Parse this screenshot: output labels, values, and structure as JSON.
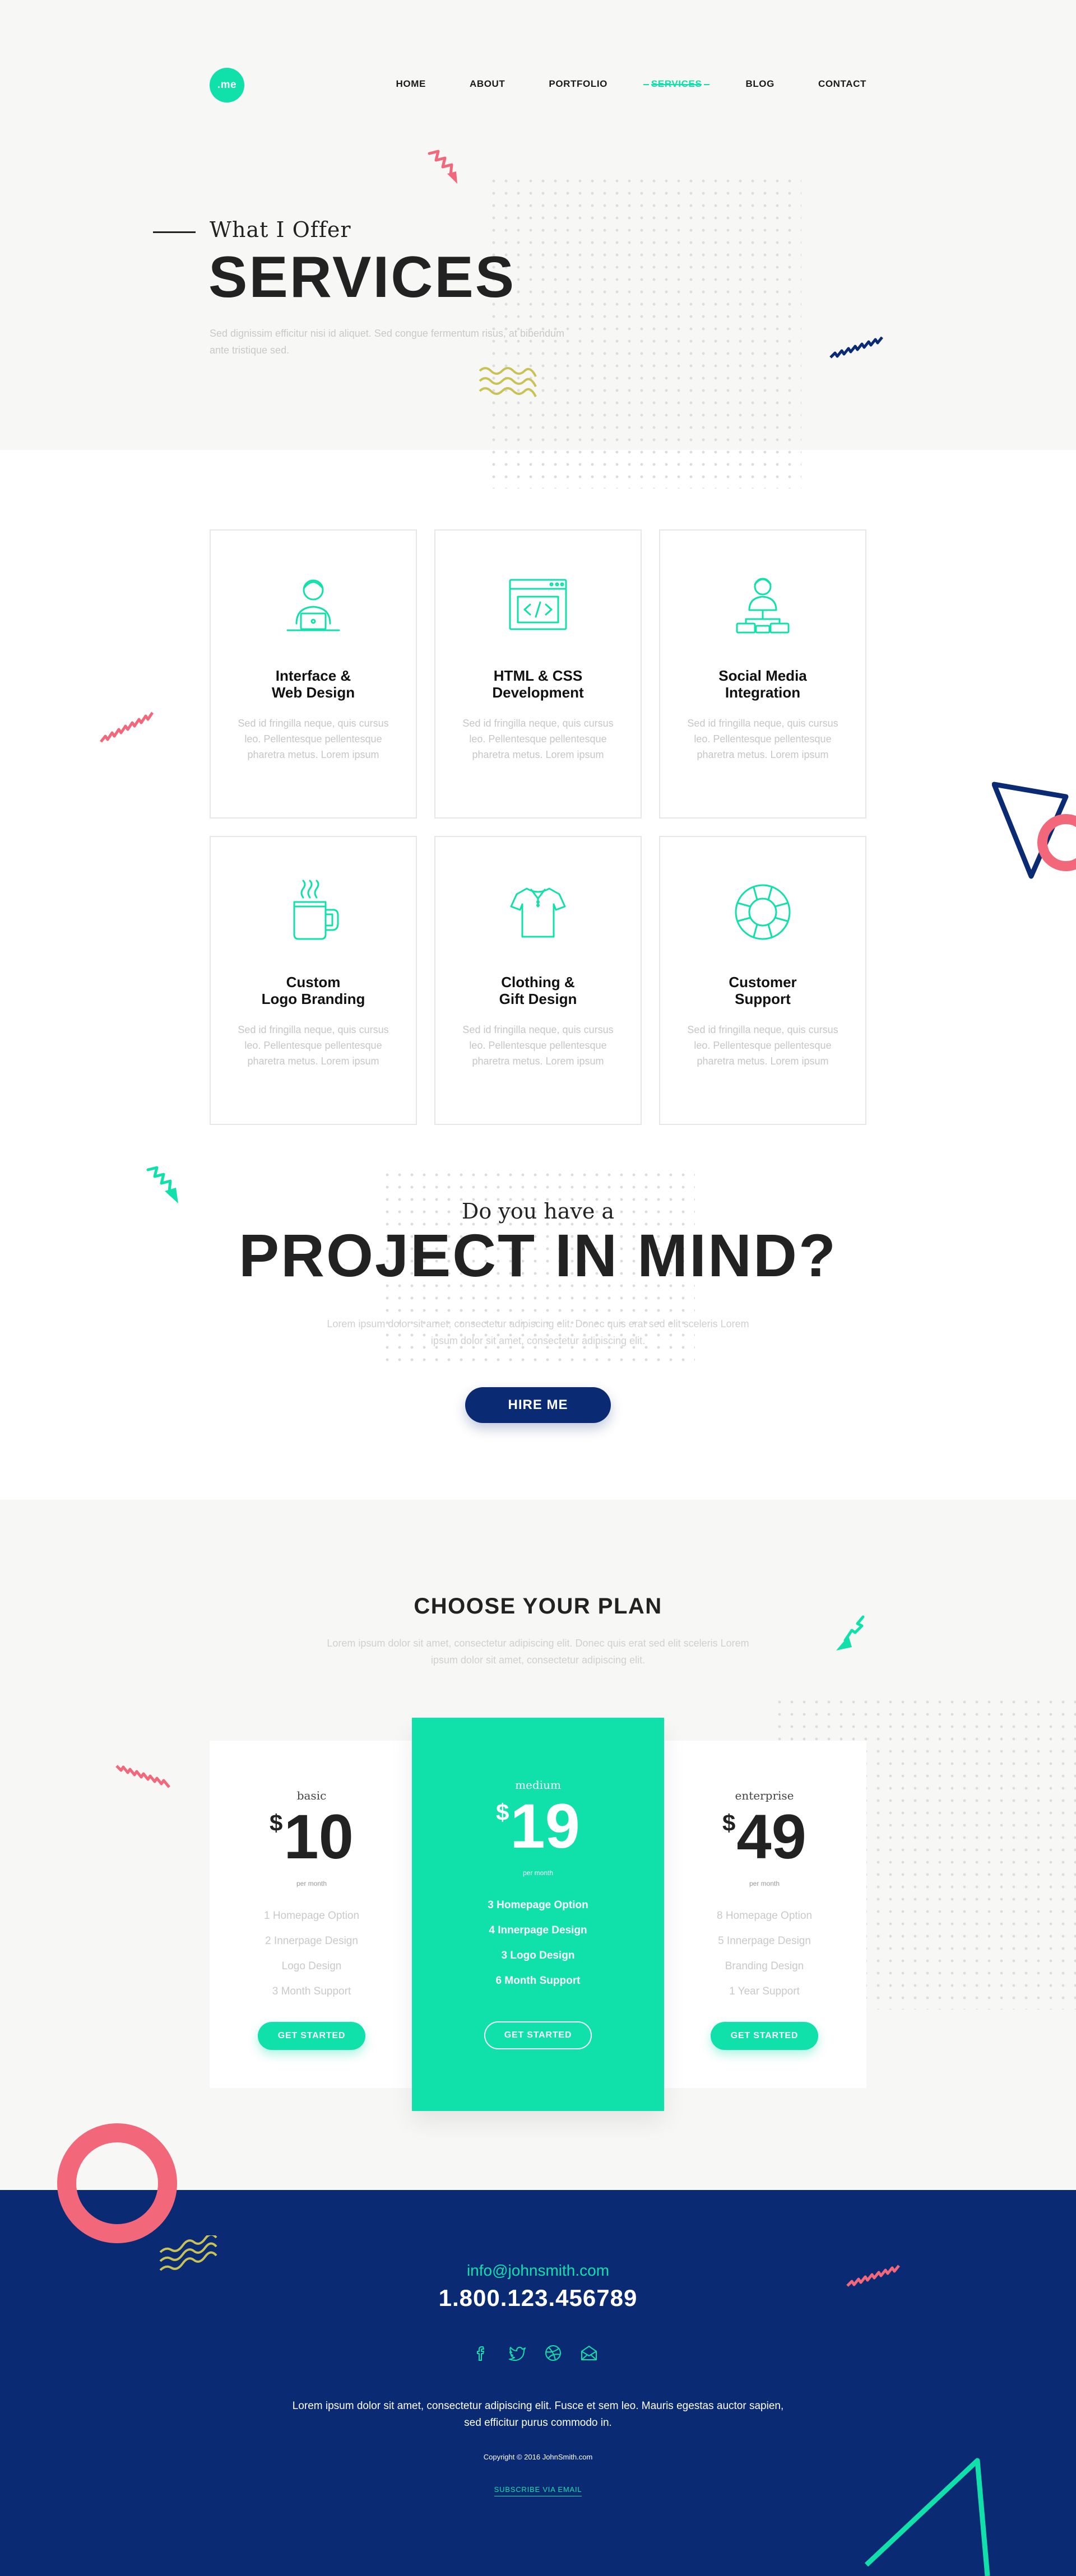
{
  "brand": {
    "logo_text": ".me",
    "accent": "#10e0aa",
    "navy": "#0a2a74",
    "coral": "#f2677a",
    "olive": "#c9c255"
  },
  "nav": {
    "items": [
      "HOME",
      "ABOUT",
      "PORTFOLIO",
      "SERVICES",
      "BLOG",
      "CONTACT"
    ],
    "active": "SERVICES"
  },
  "hero": {
    "subtitle": "What I Offer",
    "title": "SERVICES",
    "description": "Sed dignissim efficitur nisi id aliquet. Sed congue fermentum risus, at bibendum ante tristique sed."
  },
  "services": [
    {
      "icon": "designer-laptop-icon",
      "title": "Interface &\nWeb Design",
      "text": "Sed id fringilla neque, quis cursus leo. Pellentesque pellentesque pharetra metus. Lorem ipsum"
    },
    {
      "icon": "code-window-icon",
      "title": "HTML & CSS\nDevelopment",
      "text": "Sed id fringilla neque, quis cursus leo. Pellentesque pellentesque pharetra metus. Lorem ipsum"
    },
    {
      "icon": "network-person-icon",
      "title": "Social Media\nIntegration",
      "text": "Sed id fringilla neque, quis cursus leo. Pellentesque pellentesque pharetra metus. Lorem ipsum"
    },
    {
      "icon": "coffee-mug-icon",
      "title": "Custom\nLogo Branding",
      "text": "Sed id fringilla neque, quis cursus leo. Pellentesque pellentesque pharetra metus. Lorem ipsum"
    },
    {
      "icon": "tshirt-icon",
      "title": "Clothing &\nGift Design",
      "text": "Sed id fringilla neque, quis cursus leo. Pellentesque pellentesque pharetra metus. Lorem ipsum"
    },
    {
      "icon": "lifebuoy-icon",
      "title": "Customer\nSupport",
      "text": "Sed id fringilla neque, quis cursus leo. Pellentesque pellentesque pharetra metus. Lorem ipsum"
    }
  ],
  "cta": {
    "subtitle": "Do you have a",
    "title": "PROJECT IN MIND?",
    "description": "Lorem ipsum dolor sit amet, consectetur adipiscing elit. Donec quis erat sed elit sceleris Lorem ipsum dolor sit amet, consectetur adipiscing elit.",
    "button": "HIRE ME"
  },
  "pricing": {
    "title": "CHOOSE YOUR PLAN",
    "description": "Lorem ipsum dolor sit amet, consectetur adipiscing elit. Donec quis erat sed elit sceleris Lorem ipsum dolor sit amet, consectetur adipiscing elit.",
    "currency": "$",
    "period": "per month",
    "button": "GET STARTED",
    "plans": [
      {
        "name": "basic",
        "price": "10",
        "features": [
          "1 Homepage Option",
          "2 Innerpage Design",
          "Logo Design",
          "3 Month Support"
        ]
      },
      {
        "name": "medium",
        "price": "19",
        "features": [
          "3 Homepage Option",
          "4 Innerpage Design",
          "3 Logo Design",
          "6 Month Support"
        ]
      },
      {
        "name": "enterprise",
        "price": "49",
        "features": [
          "8 Homepage Option",
          "5 Innerpage Design",
          "Branding Design",
          "1 Year Support"
        ]
      }
    ]
  },
  "footer": {
    "email": "info@johnsmith.com",
    "phone": "1.800.123.456789",
    "social": [
      "facebook-icon",
      "twitter-icon",
      "dribbble-icon",
      "mail-icon"
    ],
    "text": "Lorem ipsum dolor sit amet, consectetur adipiscing elit. Fusce et sem leo. Mauris egestas auctor sapien, sed efficitur purus commodo in.",
    "copyright": "Copyright © 2016 JohnSmith.com",
    "subscribe": "SUBSCRIBE VIA EMAIL"
  }
}
